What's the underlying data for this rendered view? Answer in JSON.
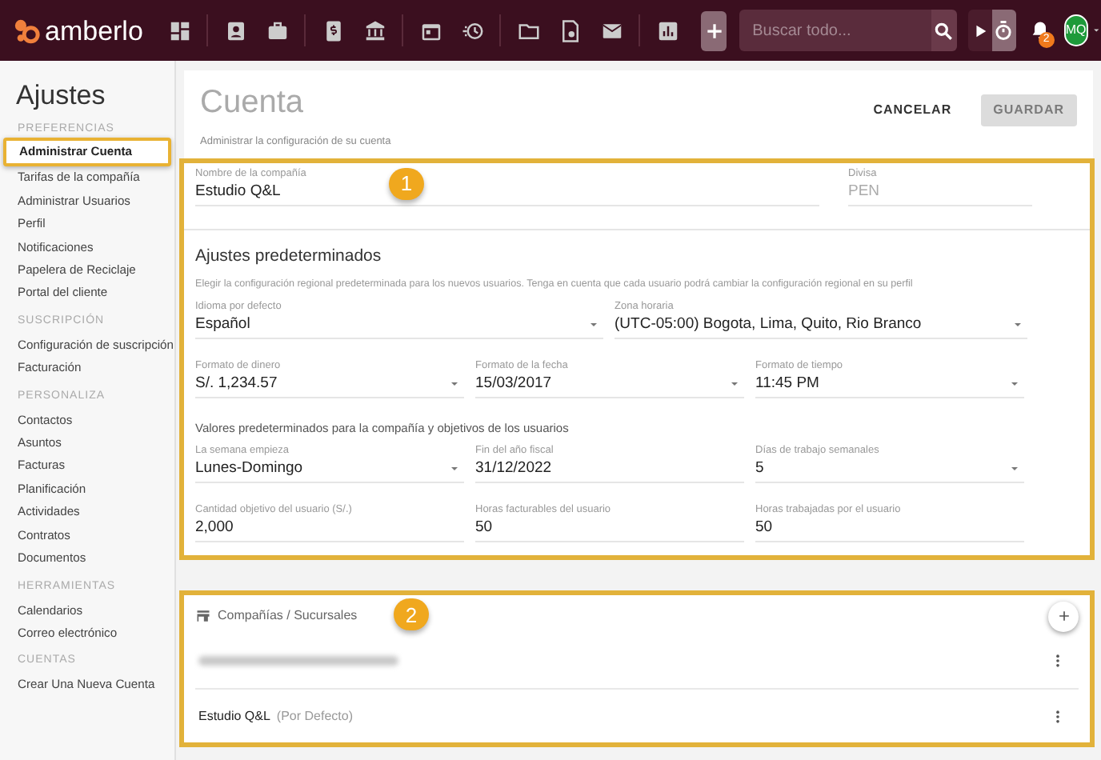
{
  "topbar": {
    "logo": "amberlo",
    "search": {
      "placeholder": "Buscar todo..."
    },
    "notifications": "2",
    "avatar": "MQ"
  },
  "sidebar": {
    "title": "Ajustes",
    "sections": [
      {
        "heading": "PREFERENCIAS",
        "items": [
          {
            "label": "Administrar Cuenta",
            "selected": true
          },
          {
            "label": "Tarifas de la compañía",
            "selected": false
          },
          {
            "label": "Administrar Usuarios",
            "selected": false
          },
          {
            "label": "Perfil",
            "selected": false
          },
          {
            "label": "Notificaciones",
            "selected": false
          },
          {
            "label": "Papelera de Reciclaje",
            "selected": false
          },
          {
            "label": "Portal del cliente",
            "selected": false
          }
        ]
      },
      {
        "heading": "SUSCRIPCIÓN",
        "items": [
          {
            "label": "Configuración de suscripción",
            "selected": false
          },
          {
            "label": "Facturación",
            "selected": false
          }
        ]
      },
      {
        "heading": "PERSONALIZA",
        "items": [
          {
            "label": "Contactos",
            "selected": false
          },
          {
            "label": "Asuntos",
            "selected": false
          },
          {
            "label": "Facturas",
            "selected": false
          },
          {
            "label": "Planificación",
            "selected": false
          },
          {
            "label": "Actividades",
            "selected": false
          },
          {
            "label": "Contratos",
            "selected": false
          },
          {
            "label": "Documentos",
            "selected": false
          }
        ]
      },
      {
        "heading": "HERRAMIENTAS",
        "items": [
          {
            "label": "Calendarios",
            "selected": false
          },
          {
            "label": "Correo electrónico",
            "selected": false
          }
        ]
      },
      {
        "heading": "CUENTAS",
        "items": [
          {
            "label": "Crear Una Nueva Cuenta",
            "selected": false
          }
        ]
      }
    ]
  },
  "page": {
    "title": "Cuenta",
    "subtitle": "Administrar la configuración de su cuenta",
    "buttons": [
      {
        "label": "CANCELAR",
        "disabled": false
      },
      {
        "label": "GUARDAR",
        "disabled": true
      }
    ]
  },
  "company": {
    "name": {
      "label": "Nombre de la compañía",
      "value": "Estudio Q&L"
    },
    "currency": {
      "label": "Divisa",
      "value": "PEN",
      "disabled": true
    },
    "callout": "1"
  },
  "defaults": {
    "title": "Ajustes predeterminados",
    "description": "Elegir la configuración regional predeterminada para los nuevos usuarios. Tenga en cuenta que cada usuario podrá cambiar la configuración regional en su perfil",
    "locale": [
      {
        "label": "Idioma por defecto",
        "value": "Español",
        "dropdown": true
      },
      {
        "label": "Zona horaria",
        "value": "(UTC-05:00) Bogota, Lima, Quito, Rio Branco",
        "dropdown": true
      }
    ],
    "formats": [
      {
        "label": "Formato de dinero",
        "value": "S/. 1,234.57",
        "dropdown": true
      },
      {
        "label": "Formato de la fecha",
        "value": "15/03/2017",
        "dropdown": true
      },
      {
        "label": "Formato de tiempo",
        "value": "11:45 PM",
        "dropdown": true
      }
    ],
    "subtitle": "Valores predeterminados para la compañía y objetivos de los usuarios",
    "week": [
      {
        "label": "La semana empieza",
        "value": "Lunes-Domingo",
        "dropdown": true
      },
      {
        "label": "Fin del año fiscal",
        "value": "31/12/2022",
        "dropdown": false
      },
      {
        "label": "Días de trabajo semanales",
        "value": "5",
        "dropdown": true
      }
    ],
    "targets": [
      {
        "label": "Cantidad objetivo del usuario (S/.)",
        "value": "2,000",
        "dropdown": false
      },
      {
        "label": "Horas facturables del usuario",
        "value": "50",
        "dropdown": false
      },
      {
        "label": "Horas trabajadas por el usuario",
        "value": "50",
        "dropdown": false
      }
    ]
  },
  "branches": {
    "title": "Compañías / Sucursales",
    "callout": "2",
    "items": [
      {
        "kind": "redacted"
      },
      {
        "kind": "named",
        "name": "Estudio Q&L",
        "note": "(Por Defecto)"
      }
    ]
  }
}
